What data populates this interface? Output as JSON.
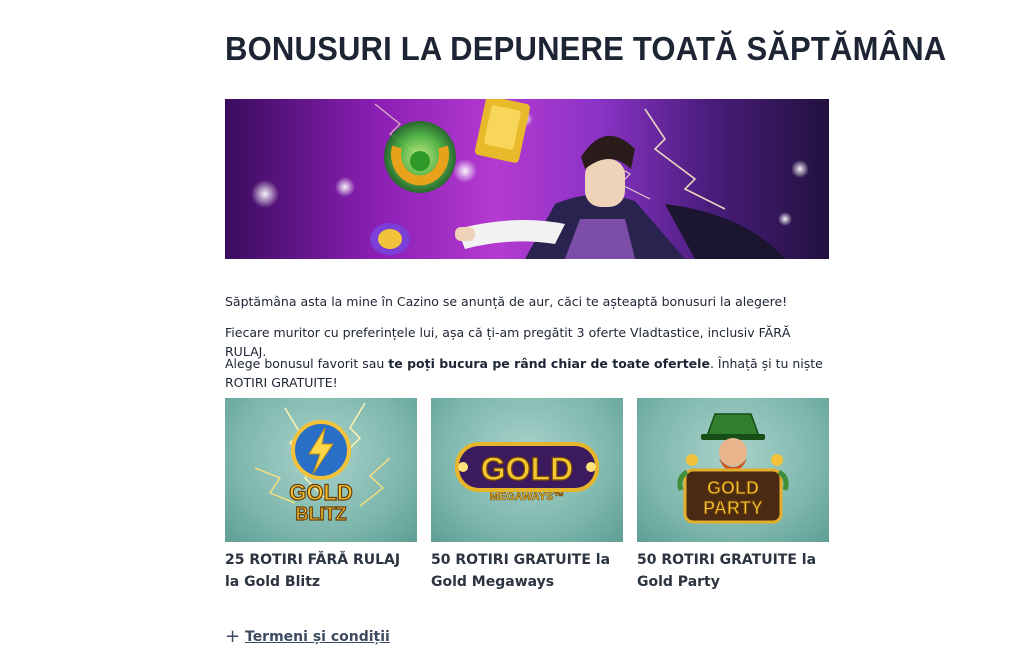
{
  "page": {
    "title": "BONUSURI LA DEPUNERE TOATĂ SĂPTĂMÂNA"
  },
  "intro": {
    "p1": "Săptămâna asta la mine în Cazino se anunță de aur, căci te așteaptă bonusuri la alegere!",
    "p2": "Fiecare muritor cu preferințele lui, așa că ți-am pregătit 3 oferte Vladtastice, inclusiv FĂRĂ RULAJ.",
    "p3_start": "Alege bonusul favorit sau ",
    "p3_bold": "te poți bucura pe rând chiar de toate ofertele",
    "p3_end": ". Înhață și tu niște ROTIRI GRATUITE!"
  },
  "offers": [
    {
      "caption": "25 ROTIRI FĂRĂ RULAJ la Gold Blitz",
      "logo_line1": "GOLD",
      "logo_line2": "BLITZ"
    },
    {
      "caption": "50 ROTIRI GRATUITE la Gold Megaways",
      "logo_line1": "GOLD",
      "logo_line2": "MEGAWAYS™"
    },
    {
      "caption": "50 ROTIRI GRATUITE la Gold Party",
      "logo_line1": "GOLD",
      "logo_line2": "PARTY"
    }
  ],
  "terms": {
    "icon": "plus-icon",
    "label": "Termeni și condiții"
  },
  "colors": {
    "title": "#1d2433",
    "text": "#1d2433",
    "card_bg": "#7fb8ae",
    "gold": "#e0a91c"
  }
}
